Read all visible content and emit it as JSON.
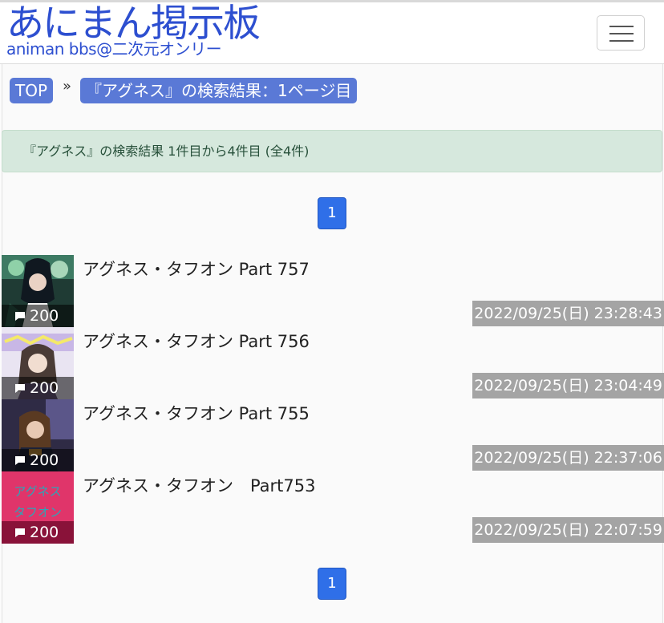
{
  "site": {
    "title": "あにまん掲示板",
    "subtitle": "animan bbs@二次元オンリー"
  },
  "breadcrumb": {
    "home": "TOP",
    "separator": "»",
    "current": "『アグネス』の検索結果：1ページ目"
  },
  "result_summary": "『アグネス』の検索結果 1件目から4件目 (全4件)",
  "pagination": {
    "current_page": "1"
  },
  "threads": [
    {
      "title": "アグネス・タフオン Part 757",
      "count": "200",
      "date": "2022/09/25(日) 23:28:43"
    },
    {
      "title": "アグネス・タフオン Part 756",
      "count": "200",
      "date": "2022/09/25(日) 23:04:49"
    },
    {
      "title": "アグネス・タフオン Part 755",
      "count": "200",
      "date": "2022/09/25(日) 22:37:06"
    },
    {
      "title": "アグネス・タフオン　Part753",
      "count": "200",
      "date": "2022/09/25(日) 22:07:59",
      "thumb_text": "アグネス タフオン"
    }
  ],
  "colors": {
    "brand": "#2d4fd0",
    "crumb_bg": "#5a79d6",
    "page_button": "#2f6fe8",
    "alert_bg": "#d6e8dd",
    "date_bg": "#a4a4a4"
  },
  "icons": {
    "menu": "hamburger-icon",
    "comment": "comment-icon"
  }
}
